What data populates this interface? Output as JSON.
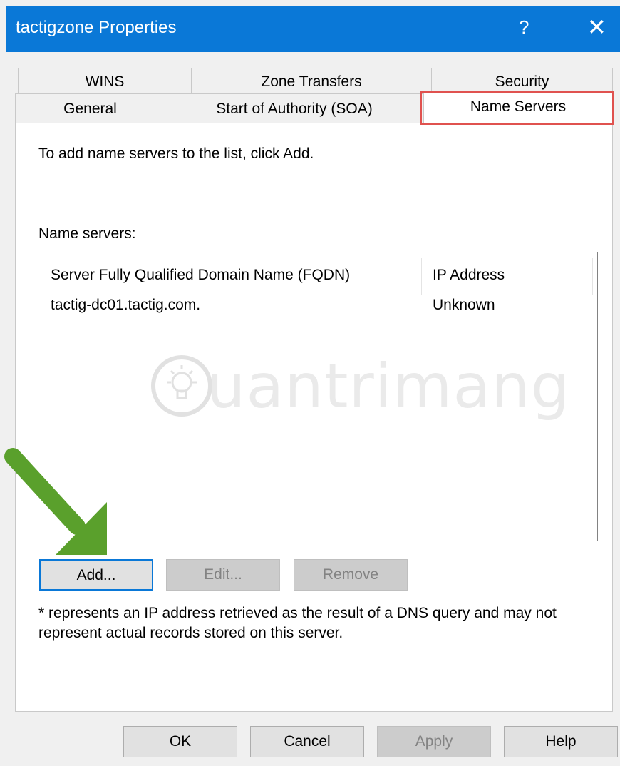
{
  "window": {
    "title": "tactigzone Properties",
    "help_label": "?",
    "close_label": "✕",
    "titlebar_color": "#0a78d7"
  },
  "tabs": {
    "top_row": [
      "WINS",
      "Zone Transfers",
      "Security"
    ],
    "bottom_row": [
      "General",
      "Start of Authority (SOA)",
      "Name Servers"
    ],
    "selected": "Name Servers",
    "highlight_color": "#e0524f"
  },
  "content": {
    "intro_text": "To add name servers to the list, click Add.",
    "list_label": "Name servers:",
    "columns": [
      "Server Fully Qualified Domain Name (FQDN)",
      "IP Address"
    ],
    "rows": [
      {
        "fqdn": "tactig-dc01.tactig.com.",
        "ip": "Unknown"
      }
    ],
    "buttons": {
      "add": "Add...",
      "edit": "Edit...",
      "remove": "Remove"
    },
    "note": "* represents an IP address retrieved as the result of a DNS query and may not represent actual records stored on this server."
  },
  "footer": {
    "ok": "OK",
    "cancel": "Cancel",
    "apply": "Apply",
    "help": "Help"
  },
  "watermark": {
    "text": "uantrimang",
    "icon": "lightbulb-icon"
  },
  "annotation": {
    "arrow_color": "#5aa02c",
    "arrow_icon": "arrow-down-right-icon"
  }
}
